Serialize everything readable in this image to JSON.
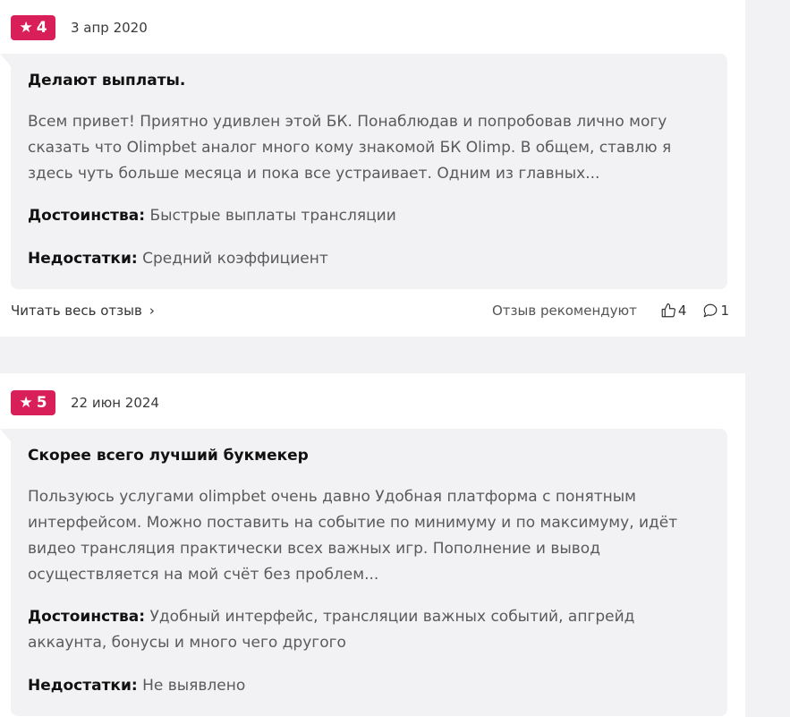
{
  "reviews": [
    {
      "rating": "4",
      "date": "3 апр 2020",
      "title": "Делают выплаты.",
      "text": "Всем привет! Приятно удивлен этой БК. Понаблюдав и попробовав лично могу сказать что Olimpbet аналог много кому знакомой БК Olimp. В общем, ставлю я здесь чуть больше месяца и пока все устраивает. Одним из главных...",
      "pros_label": "Достоинства:",
      "pros": "Быстрые выплаты трансляции",
      "cons_label": "Недостатки:",
      "cons": "Средний коэффициент",
      "read_more": "Читать весь отзыв",
      "recommended": "Отзыв рекомендуют",
      "likes": "4",
      "comments": "1"
    },
    {
      "rating": "5",
      "date": "22 июн 2024",
      "title": "Скорее всего лучший букмекер",
      "text": "Пользуюсь услугами olimpbet очень давно Удобная платформа с понятным интерфейсом. Можно поставить на событие по минимуму и по максимуму, идёт видео трансляция практически всех важных игр. Пополнение и вывод осуществляется на мой счёт без проблем...",
      "pros_label": "Достоинства:",
      "pros": "Удобный интерфейс, трансляции важных событий, апгрейд аккаунта, бонусы и много чего другого",
      "cons_label": "Недостатки:",
      "cons": "Не выявлено"
    }
  ],
  "colors": {
    "badge": "#d91f5a",
    "bubble": "#f2f2f4"
  },
  "icons": {
    "star": "star-icon",
    "like": "thumbs-up-icon",
    "comment": "comment-icon",
    "chevron": "chevron-right-icon"
  }
}
